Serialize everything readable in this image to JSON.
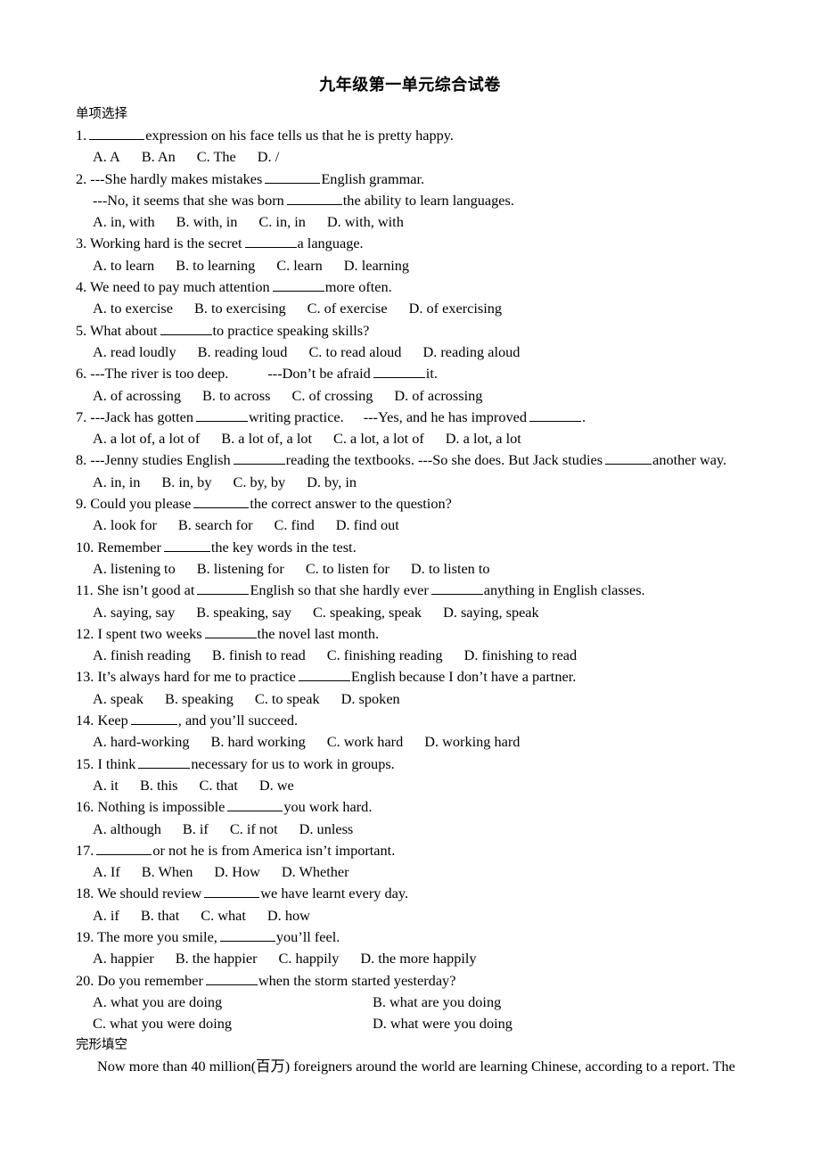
{
  "document": {
    "title": "九年级第一单元综合试卷",
    "sections": [
      {
        "heading": "单项选择"
      },
      {
        "heading": "完形填空"
      }
    ]
  },
  "multiple_choice": {
    "heading": "单项选择",
    "questions": [
      {
        "number": "1.",
        "stem_before": "",
        "stem_after": "expression on his face tells us that he is pretty happy.",
        "options": [
          "A. A",
          "B. An",
          "C. The",
          "D. /"
        ]
      },
      {
        "number": "2.",
        "line1": "---She hardly makes mistakes",
        "line1_after": "English grammar.",
        "line2": "---No, it seems that she was born",
        "line2_after": "the ability to learn languages.",
        "options": [
          "A. in, with",
          "B. with, in",
          "C. in, in",
          "D. with, with"
        ]
      },
      {
        "number": "3.",
        "stem_before": "Working hard is the secret",
        "stem_after": "a language.",
        "options": [
          "A. to learn",
          "B. to learning",
          "C. learn",
          "D. learning"
        ]
      },
      {
        "number": "4.",
        "stem_before": "We need to pay much attention",
        "stem_after": "more often.",
        "options": [
          "A. to exercise",
          "B. to exercising",
          "C. of exercise",
          "D. of exercising"
        ]
      },
      {
        "number": "5.",
        "stem_before": "What about",
        "stem_after": "to practice speaking skills?",
        "options": [
          "A. read loudly",
          "B. reading loud",
          "C. to read aloud",
          "D. reading aloud"
        ]
      },
      {
        "number": "6.",
        "stem_before": "---The river is too deep.",
        "stem_mid": "---Don’t be afraid",
        "stem_after": "it.",
        "options": [
          "A. of acrossing",
          "B. to across",
          "C. of crossing",
          "D. of acrossing"
        ]
      },
      {
        "number": "7.",
        "stem_before": "---Jack has gotten",
        "stem_mid": "writing practice.",
        "stem_mid2": "---Yes, and he has improved",
        "stem_after": ".",
        "options": [
          "A. a lot of, a lot of",
          "B. a lot of, a lot",
          "C. a lot, a lot of",
          "D. a lot, a lot"
        ]
      },
      {
        "number": "8.",
        "stem_before": "---Jenny studies English",
        "stem_mid": "reading the textbooks. ---So she does. But Jack studies",
        "stem_after": "another way.",
        "options": [
          "A. in, in",
          "B. in, by",
          "C. by, by",
          "D. by, in"
        ]
      },
      {
        "number": "9.",
        "stem_before": "Could you please",
        "stem_after": "the correct answer to the question?",
        "options": [
          "A. look for",
          "B. search for",
          "C. find",
          "D. find out"
        ]
      },
      {
        "number": "10.",
        "stem_before": "Remember",
        "stem_after": "the key words in the test.",
        "options": [
          "A. listening to",
          "B. listening for",
          "C. to listen for",
          "D. to listen to"
        ]
      },
      {
        "number": "11.",
        "stem_before": "She isn’t good at",
        "stem_mid": "English so that she hardly ever",
        "stem_after": "anything in English classes.",
        "options": [
          "A. saying, say",
          "B. speaking, say",
          "C. speaking, speak",
          "D. saying, speak"
        ]
      },
      {
        "number": "12.",
        "stem_before": "I spent two weeks",
        "stem_after": "the novel last month.",
        "options": [
          "A. finish reading",
          "B. finish to read",
          "C. finishing reading",
          "D. finishing to read"
        ]
      },
      {
        "number": "13.",
        "stem_before": "It’s always hard for me to practice",
        "stem_after": "English because I don’t have a partner.",
        "options": [
          "A. speak",
          "B. speaking",
          "C. to speak",
          "D. spoken"
        ]
      },
      {
        "number": "14.",
        "stem_before": "Keep",
        "stem_after": ", and you’ll succeed.",
        "options": [
          "A. hard-working",
          "B. hard working",
          "C. work hard",
          "D. working hard"
        ]
      },
      {
        "number": "15.",
        "stem_before": "I think",
        "stem_after": "necessary for us to work in groups.",
        "options": [
          "A. it",
          "B. this",
          "C. that",
          "D. we"
        ]
      },
      {
        "number": "16.",
        "stem_before": "Nothing is impossible",
        "stem_after": "you work hard.",
        "options": [
          "A. although",
          "B. if",
          "C. if not",
          "D. unless"
        ]
      },
      {
        "number": "17.",
        "stem_before": "",
        "stem_after": "or not he is from America isn’t important.",
        "options": [
          "A. If",
          "B. When",
          "D. How",
          "D. Whether"
        ]
      },
      {
        "number": "18.",
        "stem_before": "We should review",
        "stem_after": "we have learnt every day.",
        "options": [
          "A. if",
          "B. that",
          "C. what",
          "D. how"
        ]
      },
      {
        "number": "19.",
        "stem_before": "The more you smile,",
        "stem_after": "you’ll feel.",
        "options": [
          "A. happier",
          "B. the happier",
          "C. happily",
          "D. the more happily"
        ]
      },
      {
        "number": "20.",
        "stem_before": "Do you remember",
        "stem_after": "when the storm started yesterday?",
        "options": [
          "A. what you are doing",
          "B. what are you doing",
          "C. what you were doing",
          "D. what were you doing"
        ]
      }
    ]
  },
  "cloze": {
    "heading": "完形填空",
    "paragraph": "Now more than 40 million(百万) foreigners around the world are learning Chinese, according to a report. The"
  }
}
